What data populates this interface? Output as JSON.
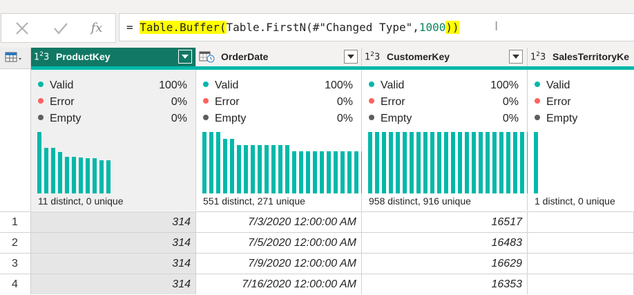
{
  "formula_bar": {
    "cancel_icon": "x-icon",
    "commit_icon": "check-icon",
    "fx_label": "fx",
    "equals": "= ",
    "func_name": "Table.Buffer",
    "open_paren": "(",
    "inner": "Table.FirstN(#\"Changed Type\",",
    "count": "1000",
    "inner_close": ")",
    "close_paren": ")"
  },
  "columns": [
    {
      "type_label": "1²₃",
      "name": "ProductKey",
      "valid": "100%",
      "error": "0%",
      "empty": "0%",
      "distinct": "11 distinct, 0 unique",
      "histogram": [
        0.7,
        0.52,
        0.52,
        0.47,
        0.42,
        0.42,
        0.41,
        0.4,
        0.4,
        0.38,
        0.38
      ]
    },
    {
      "type_label": "date-time-type-icon",
      "name": "OrderDate",
      "valid": "100%",
      "error": "0%",
      "empty": "0%",
      "distinct": "551 distinct, 271 unique",
      "histogram": [
        0.7,
        0.7,
        0.7,
        0.62,
        0.62,
        0.55,
        0.55,
        0.55,
        0.55,
        0.55,
        0.55,
        0.55,
        0.55,
        0.48,
        0.48,
        0.48,
        0.48,
        0.48,
        0.48,
        0.48,
        0.48,
        0.48,
        0.48,
        0.48,
        0.48,
        0.48,
        0.48,
        0.48,
        0.48,
        0.48
      ]
    },
    {
      "type_label": "1²₃",
      "name": "CustomerKey",
      "valid": "100%",
      "error": "0%",
      "empty": "0%",
      "distinct": "958 distinct, 916 unique",
      "histogram": [
        0.7,
        0.7,
        0.7,
        0.7,
        0.7,
        0.7,
        0.7,
        0.7,
        0.7,
        0.7,
        0.7,
        0.7,
        0.7,
        0.7,
        0.7,
        0.7,
        0.7,
        0.7,
        0.7,
        0.7,
        0.7,
        0.7,
        0.7,
        0.7,
        0.7,
        0.7,
        0.7,
        0.7,
        0.7,
        0.7
      ]
    },
    {
      "type_label": "1²₃",
      "name": "SalesTerritoryKe",
      "valid": "",
      "error": "",
      "empty": "",
      "distinct": "1 distinct, 0 unique",
      "histogram": [
        0.7
      ]
    }
  ],
  "labels": {
    "valid": "Valid",
    "error": "Error",
    "empty": "Empty"
  },
  "rows": [
    {
      "num": "1",
      "product": "314",
      "date": "7/3/2020 12:00:00 AM",
      "customer": "16517"
    },
    {
      "num": "2",
      "product": "314",
      "date": "7/5/2020 12:00:00 AM",
      "customer": "16483"
    },
    {
      "num": "3",
      "product": "314",
      "date": "7/9/2020 12:00:00 AM",
      "customer": "16629"
    },
    {
      "num": "4",
      "product": "314",
      "date": "7/16/2020 12:00:00 AM",
      "customer": "16353"
    }
  ],
  "colors": {
    "valid": "#01b8aa",
    "error": "#fd625e",
    "empty": "#605e5c",
    "selected_header": "#117865"
  }
}
